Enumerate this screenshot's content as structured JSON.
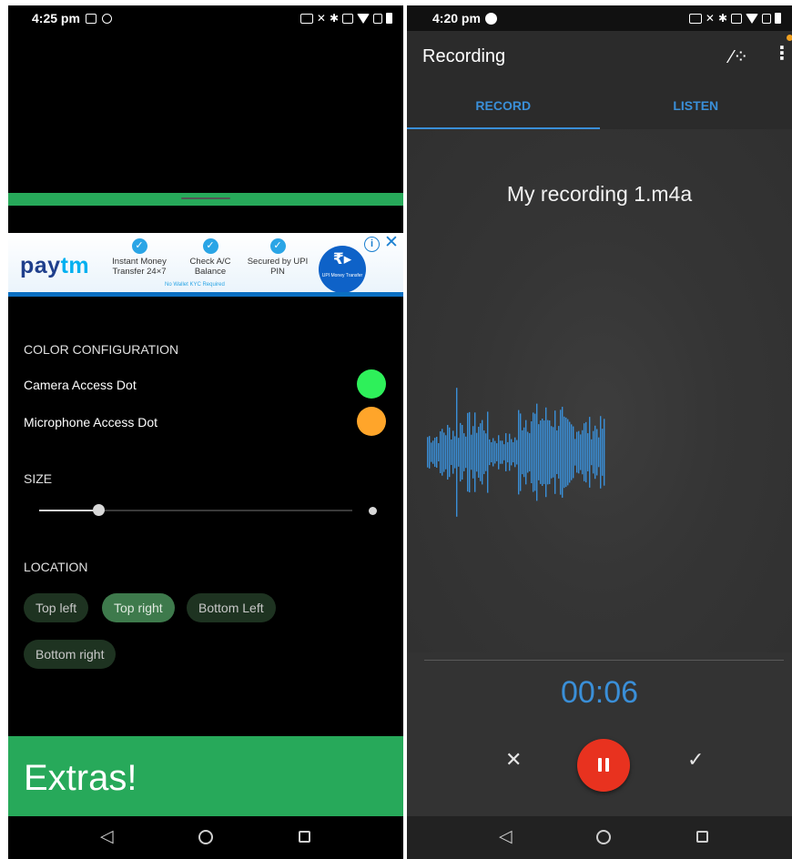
{
  "left": {
    "status": {
      "time": "4:25 pm"
    },
    "colors": {
      "green": "#27a95a",
      "camera_dot": "#2ef05a",
      "mic_dot": "#ffa52a"
    },
    "ad": {
      "logo_a": "pay",
      "logo_b": "tm",
      "features": [
        "Instant Money Transfer 24×7",
        "Check A/C Balance",
        "Secured by UPI PIN"
      ],
      "note": "No Wallet KYC Required",
      "coin_symbol": "₹▸",
      "coin_caption": "UPI Money Transfer",
      "info_glyph": "i",
      "close_glyph": "✕"
    },
    "color_config": {
      "heading": "COLOR CONFIGURATION",
      "camera_label": "Camera Access Dot",
      "mic_label": "Microphone Access Dot"
    },
    "size": {
      "heading": "SIZE",
      "value_fraction": 0.19
    },
    "location": {
      "heading": "LOCATION",
      "options": [
        "Top left",
        "Top right",
        "Bottom Left",
        "Bottom right"
      ],
      "selected": "Top right"
    },
    "extras": "Extras!",
    "nav": {
      "back": "◁",
      "home": "",
      "recents": ""
    }
  },
  "right": {
    "status": {
      "time": "4:20 pm"
    },
    "toolbar": {
      "title": "Recording",
      "wand_icon": "magic-wand-icon",
      "more_glyph": "⋮"
    },
    "tabs": [
      "RECORD",
      "LISTEN"
    ],
    "active_tab": "RECORD",
    "file_name": "My recording 1.m4a",
    "timer": "00:06",
    "wave_color": "#3a8fd8",
    "controls": {
      "discard": "✕",
      "save": "✓"
    },
    "nav": {
      "back": "◁"
    }
  }
}
